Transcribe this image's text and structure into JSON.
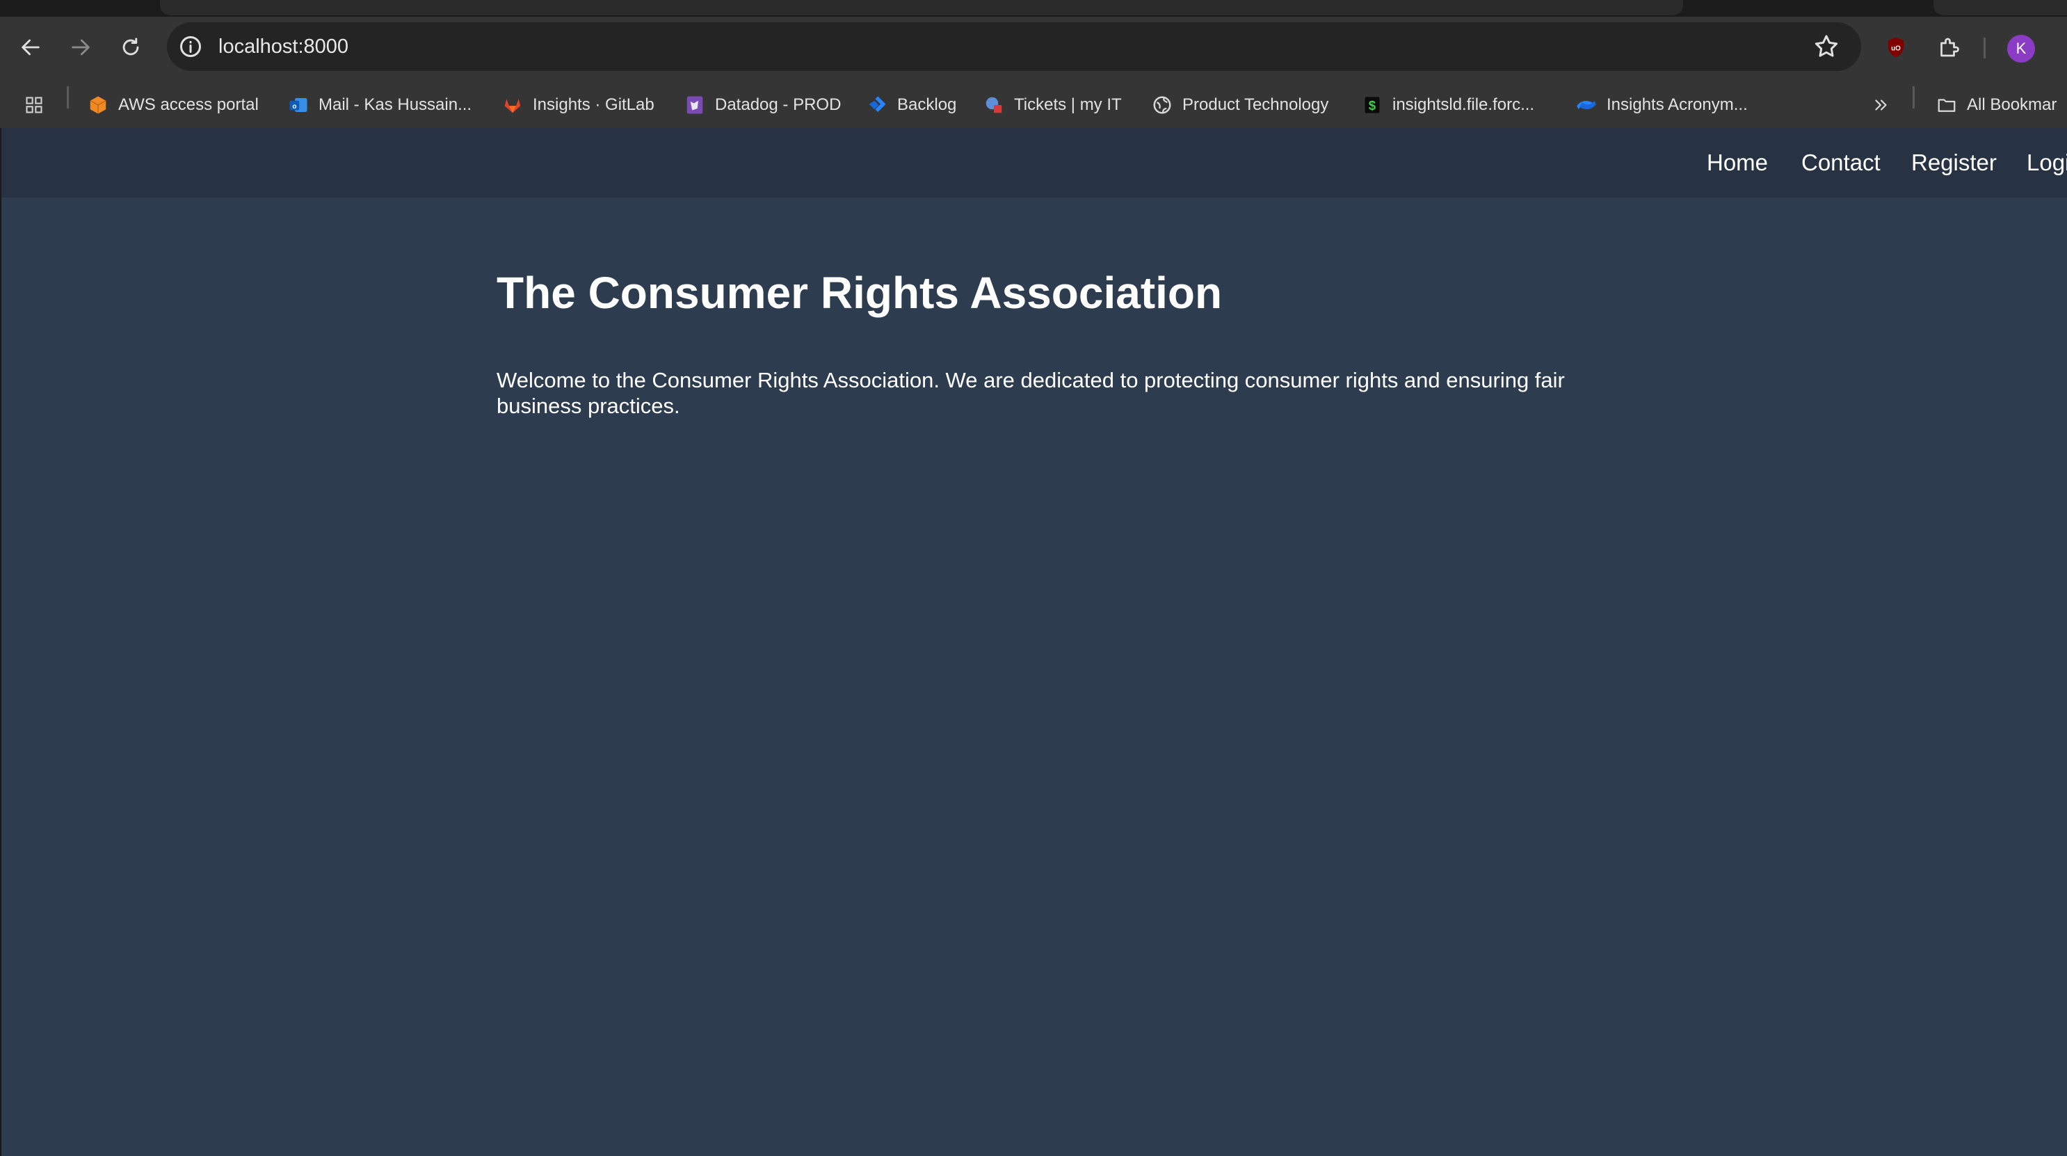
{
  "browser": {
    "url": "localhost:8000",
    "avatar_initial": "K",
    "bookmarks": [
      {
        "label": "AWS access portal",
        "icon": "aws-cube-icon"
      },
      {
        "label": "Mail - Kas Hussain...",
        "icon": "outlook-mail-icon"
      },
      {
        "label": "Insights · GitLab",
        "icon": "gitlab-icon"
      },
      {
        "label": "Datadog - PROD",
        "icon": "datadog-icon"
      },
      {
        "label": "Backlog",
        "icon": "jira-icon"
      },
      {
        "label": "Tickets | my IT",
        "icon": "tickets-icon"
      },
      {
        "label": "Product Technology",
        "icon": "globe-icon"
      },
      {
        "label": "insightsld.file.forc...",
        "icon": "salesforce-s-icon"
      },
      {
        "label": "Insights Acronym...",
        "icon": "confluence-icon"
      }
    ],
    "all_bookmarks_label": "All Bookmar"
  },
  "site": {
    "nav": {
      "home": "Home",
      "contact": "Contact",
      "register": "Register",
      "login": "Logi"
    },
    "title": "The Consumer Rights Association",
    "intro": "Welcome to the Consumer Rights Association. We are dedicated to protecting consumer rights and ensuring fair business practices."
  },
  "colors": {
    "page_background": "#2e3c4f",
    "navbar_background": "#273342",
    "avatar": "#8a3cc4"
  }
}
